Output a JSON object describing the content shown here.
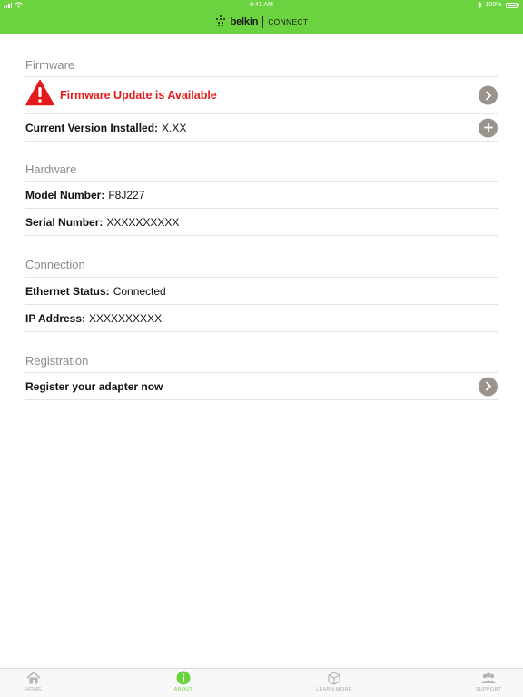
{
  "status_bar": {
    "time": "9:41 AM",
    "battery": "100%"
  },
  "header": {
    "brand": "belkin",
    "product": "CONNECT"
  },
  "sections": {
    "firmware": {
      "title": "Firmware",
      "update_text": "Firmware Update is Available",
      "version_label": "Current Version Installed:",
      "version_value": "X.XX"
    },
    "hardware": {
      "title": "Hardware",
      "model_label": "Model Number:",
      "model_value": "F8J227",
      "serial_label": "Serial Number:",
      "serial_value": "XXXXXXXXXX"
    },
    "connection": {
      "title": "Connection",
      "ethernet_label": "Ethernet Status:",
      "ethernet_value": "Connected",
      "ip_label": "IP Address:",
      "ip_value": "XXXXXXXXXX"
    },
    "registration": {
      "title": "Registration",
      "register_text": "Register your adapter now"
    }
  },
  "tabs": [
    {
      "label": "HOME",
      "icon": "home-icon"
    },
    {
      "label": "ABOUT",
      "icon": "info-icon",
      "active": true
    },
    {
      "label": "LEARN MORE",
      "icon": "box-icon"
    },
    {
      "label": "SUPPORT",
      "icon": "people-icon"
    }
  ],
  "colors": {
    "accent": "#6bd33f",
    "alert": "#e11b1b",
    "disclosure": "#9b938d"
  }
}
